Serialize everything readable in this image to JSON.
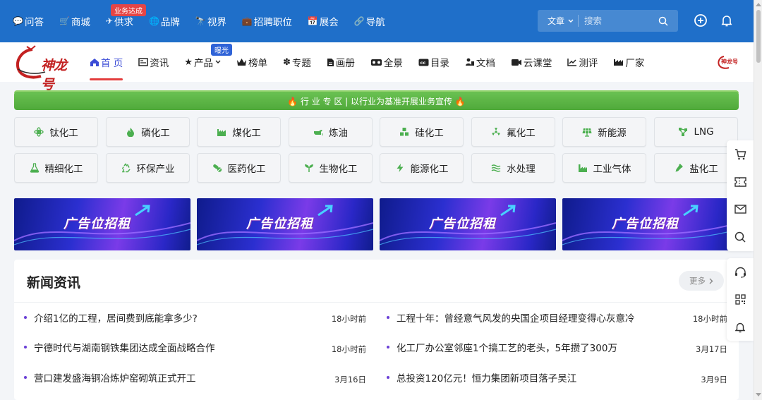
{
  "topnav": {
    "items": [
      {
        "label": "问答",
        "icon": "chat-bubble-icon"
      },
      {
        "label": "商城",
        "icon": "cart-icon"
      },
      {
        "label": "供求",
        "icon": "paper-plane-icon"
      },
      {
        "label": "品牌",
        "icon": "globe-icon"
      },
      {
        "label": "视界",
        "icon": "binoculars-icon"
      },
      {
        "label": "招聘职位",
        "icon": "briefcase-icon"
      },
      {
        "label": "展会",
        "icon": "calendar-icon"
      },
      {
        "label": "导航",
        "icon": "link-icon"
      }
    ],
    "badge": "业务达成",
    "search_type": "文章",
    "search_placeholder": "搜索"
  },
  "logo_text": "神龙号",
  "mini_logo_text": "神龙号",
  "mainnav": {
    "items": [
      {
        "label": "首 页",
        "icon": "home-icon",
        "active": true
      },
      {
        "label": "资讯",
        "icon": "newspaper-icon"
      },
      {
        "label": "产品",
        "icon": "star-icon"
      },
      {
        "label": "榜单",
        "icon": "crown-icon"
      },
      {
        "label": "专题",
        "icon": "leaf-icon"
      },
      {
        "label": "画册",
        "icon": "file-icon"
      },
      {
        "label": "全景",
        "icon": "vr-icon"
      },
      {
        "label": "目录",
        "icon": "cc-icon"
      },
      {
        "label": "文档",
        "icon": "people-icon"
      },
      {
        "label": "云课堂",
        "icon": "video-icon"
      },
      {
        "label": "测评",
        "icon": "chart-line-icon"
      },
      {
        "label": "厂家",
        "icon": "factory-icon"
      }
    ],
    "badge": "曝光"
  },
  "strip_text": "🔥 行 业 专 区 | 以行业为基准开展业务宣传 🔥",
  "categories": [
    {
      "label": "钛化工",
      "icon": "atom-icon"
    },
    {
      "label": "磷化工",
      "icon": "flame-icon"
    },
    {
      "label": "煤化工",
      "icon": "factory-icon"
    },
    {
      "label": "炼油",
      "icon": "oil-icon"
    },
    {
      "label": "硅化工",
      "icon": "cubes-icon"
    },
    {
      "label": "氟化工",
      "icon": "radiation-icon"
    },
    {
      "label": "新能源",
      "icon": "solar-panel-icon"
    },
    {
      "label": "LNG",
      "icon": "network-icon"
    },
    {
      "label": "精细化工",
      "icon": "flask-icon"
    },
    {
      "label": "环保产业",
      "icon": "recycle-icon"
    },
    {
      "label": "医药化工",
      "icon": "pills-icon"
    },
    {
      "label": "生物化工",
      "icon": "seedling-icon"
    },
    {
      "label": "能源化工",
      "icon": "bolt-icon"
    },
    {
      "label": "水处理",
      "icon": "water-icon"
    },
    {
      "label": "工业气体",
      "icon": "industry-icon"
    },
    {
      "label": "盐化工",
      "icon": "eyedropper-icon"
    }
  ],
  "ads": [
    {
      "text": "广告位招租"
    },
    {
      "text": "广告位招租"
    },
    {
      "text": "广告位招租"
    },
    {
      "text": "广告位招租"
    }
  ],
  "news": {
    "title": "新闻资讯",
    "more": "更多",
    "left": [
      {
        "title": "介绍1亿的工程，居间费到底能拿多少?",
        "time": "18小时前"
      },
      {
        "title": "宁德时代与湖南钢铁集团达成全面战略合作",
        "time": "18小时前"
      },
      {
        "title": "营口建发盛海铜冶炼炉窑砌筑正式开工",
        "time": "3月16日"
      }
    ],
    "right": [
      {
        "title": "工程十年：曾经意气风发的央国企项目经理变得心灰意冷",
        "time": "18小时前"
      },
      {
        "title": "化工厂办公室邻座1个搞工艺的老头，5年攒了300万",
        "time": "3月17日"
      },
      {
        "title": "总投资120亿元！恒力集团新项目落子吴江",
        "time": "3月9日"
      }
    ]
  },
  "colors": {
    "topbar": "#1f6fc9",
    "accent_green": "#4fa93a",
    "category_icon": "#4caf50",
    "active_nav": "#3a4bd6",
    "badge_red": "#e54545",
    "badge_blue": "#2f63d7"
  }
}
